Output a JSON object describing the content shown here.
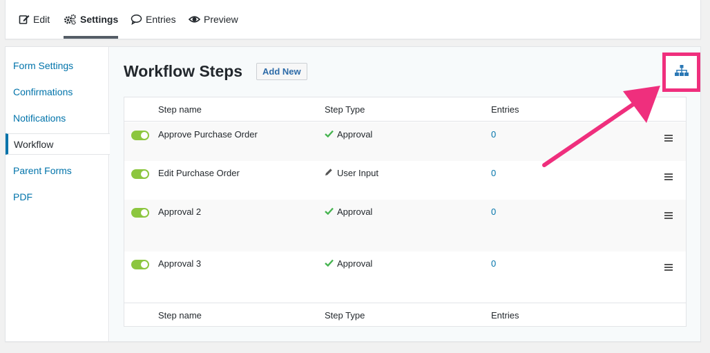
{
  "tabs": [
    {
      "label": "Edit",
      "icon": "edit-icon"
    },
    {
      "label": "Settings",
      "icon": "gears-icon"
    },
    {
      "label": "Entries",
      "icon": "speech-bubble-icon"
    },
    {
      "label": "Preview",
      "icon": "eye-icon"
    }
  ],
  "active_tab": "Settings",
  "sidebar": {
    "items": [
      {
        "label": "Form Settings"
      },
      {
        "label": "Confirmations"
      },
      {
        "label": "Notifications"
      },
      {
        "label": "Workflow"
      },
      {
        "label": "Parent Forms"
      },
      {
        "label": "PDF"
      }
    ],
    "active": "Workflow"
  },
  "main": {
    "title": "Workflow Steps",
    "add_new_label": "Add New",
    "flow_button_icon": "sitemap-icon",
    "columns": [
      "Step name",
      "Step Type",
      "Entries"
    ],
    "steps": [
      {
        "name": "Approve Purchase Order",
        "type": "Approval",
        "type_icon": "checkmark-icon",
        "entries": "0",
        "active": true
      },
      {
        "name": "Edit Purchase Order",
        "type": "User Input",
        "type_icon": "pencil-icon",
        "entries": "0",
        "active": true
      },
      {
        "name": "Approval 2",
        "type": "Approval",
        "type_icon": "checkmark-icon",
        "entries": "0",
        "active": true
      },
      {
        "name": "Approval 3",
        "type": "Approval",
        "type_icon": "checkmark-icon",
        "entries": "0",
        "active": true
      }
    ]
  },
  "colors": {
    "accent": "#0073aa",
    "toggle_on": "#8cc63f",
    "highlight": "#ef2f7d",
    "check": "#46b450"
  }
}
